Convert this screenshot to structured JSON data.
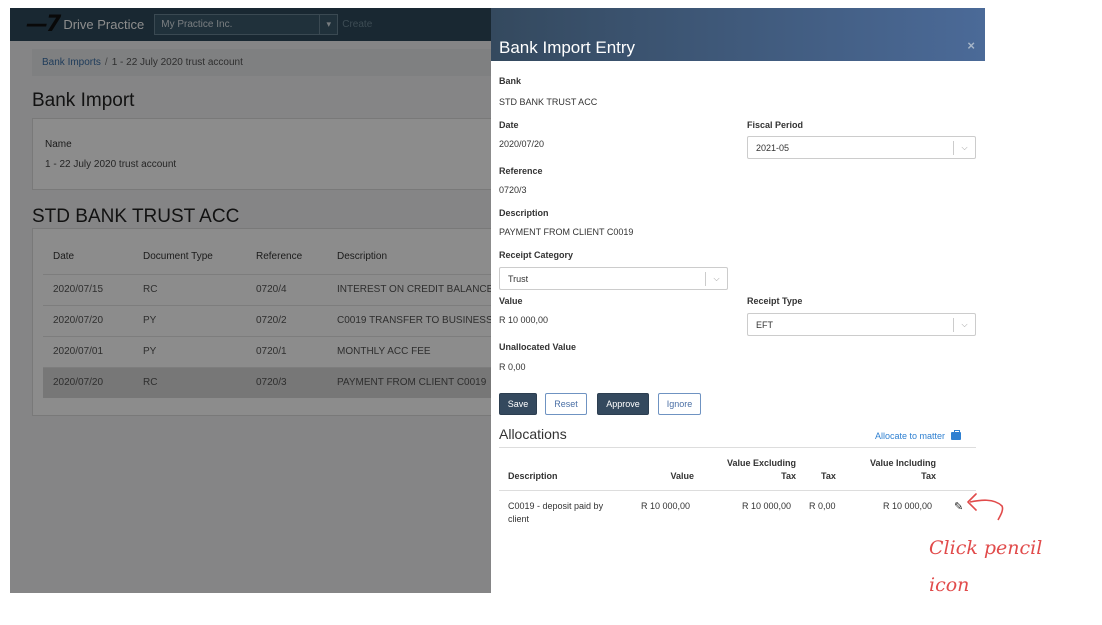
{
  "app": {
    "logo_text": "Drive Practice",
    "company": "My Practice Inc.",
    "create_label": "Create"
  },
  "breadcrumb": {
    "parent": "Bank Imports",
    "separator": "/",
    "current": "1 - 22 July 2020 trust account"
  },
  "page": {
    "title": "Bank Import",
    "name_label": "Name",
    "name_value": "1 - 22 July 2020 trust account",
    "section_title": "STD BANK TRUST ACC"
  },
  "bg_table": {
    "headers": [
      "Date",
      "Document Type",
      "Reference",
      "Description"
    ],
    "rows": [
      [
        "2020/07/15",
        "RC",
        "0720/4",
        "INTEREST ON CREDIT BALANCE"
      ],
      [
        "2020/07/20",
        "PY",
        "0720/2",
        "C0019 TRANSFER TO BUSINESS"
      ],
      [
        "2020/07/01",
        "PY",
        "0720/1",
        "MONTHLY ACC FEE"
      ],
      [
        "2020/07/20",
        "RC",
        "0720/3",
        "PAYMENT FROM CLIENT C0019"
      ]
    ]
  },
  "modal": {
    "title": "Bank Import Entry",
    "close": "×",
    "bank_label": "Bank",
    "bank_value": "STD BANK TRUST ACC",
    "date_label": "Date",
    "date_value": "2020/07/20",
    "fiscal_label": "Fiscal Period",
    "fiscal_value": "2021-05",
    "reference_label": "Reference",
    "reference_value": "0720/3",
    "description_label": "Description",
    "description_value": "PAYMENT FROM CLIENT C0019",
    "receipt_category_label": "Receipt Category",
    "receipt_category_value": "Trust",
    "value_label": "Value",
    "value_value": "R 10 000,00",
    "receipt_type_label": "Receipt Type",
    "receipt_type_value": "EFT",
    "unallocated_label": "Unallocated Value",
    "unallocated_value": "R 0,00",
    "buttons": {
      "save": "Save",
      "reset": "Reset",
      "approve": "Approve",
      "ignore": "Ignore"
    }
  },
  "allocations": {
    "title": "Allocations",
    "allocate_link": "Allocate to matter",
    "headers": {
      "description": "Description",
      "value": "Value",
      "value_excl_1": "Value Excluding",
      "value_excl_2": "Tax",
      "tax": "Tax",
      "value_incl_1": "Value Including",
      "value_incl_2": "Tax"
    },
    "row": {
      "description_1": "C0019 - deposit paid by",
      "description_2": "client",
      "value": "R 10 000,00",
      "value_excl": "R 10 000,00",
      "tax": "R 0,00",
      "value_incl": "R 10 000,00"
    }
  },
  "annotation": {
    "line1": "Click pencil",
    "line2": "icon",
    "color": "#e14b4b"
  }
}
